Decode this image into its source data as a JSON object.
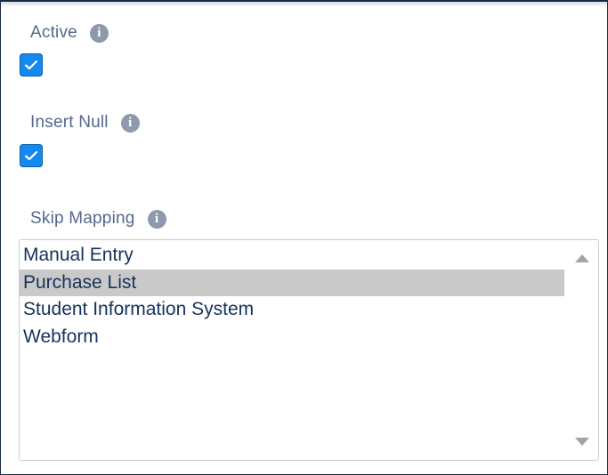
{
  "fields": {
    "active": {
      "label": "Active",
      "info_icon": "info-icon",
      "checked": true
    },
    "insert_null": {
      "label": "Insert Null",
      "info_icon": "info-icon",
      "checked": true
    },
    "skip_mapping": {
      "label": "Skip Mapping",
      "info_icon": "info-icon",
      "options": [
        "Manual Entry",
        "Purchase List",
        "Student Information System",
        "Webform"
      ],
      "selected": "Purchase List"
    }
  },
  "icons": {
    "info": "i",
    "checkmark": "checkmark-icon",
    "scroll_up": "scroll-up-arrow",
    "scroll_down": "scroll-down-arrow"
  },
  "colors": {
    "label": "#54698d",
    "checkbox": "#1589ee",
    "info_icon": "#8e9aab",
    "option_text": "#16325c",
    "selected_option": "#c9c9c9"
  }
}
